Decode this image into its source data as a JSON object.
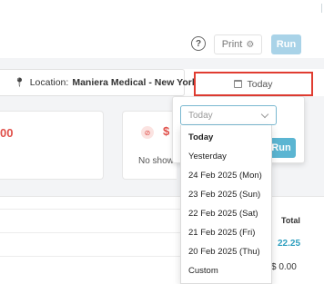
{
  "header": {
    "help_icon": "question-circle-icon",
    "print_label": "Print",
    "print_icon": "gear-icon",
    "run_label": "Run"
  },
  "filters": {
    "location_label": "Location:",
    "location_value": "Maniera Medical - New York",
    "date_label": "Today"
  },
  "cards": {
    "left_amount": "00",
    "right_amount": "$",
    "right_caption": "No show"
  },
  "table": {
    "total_header": "Total",
    "totals": [
      "22.25",
      "$ 0.00"
    ]
  },
  "date_popover": {
    "select_value": "Today",
    "run_label": "Run",
    "options": [
      "Today",
      "Yesterday",
      "24 Feb 2025 (Mon)",
      "23 Feb 2025 (Sun)",
      "22 Feb 2025 (Sat)",
      "21 Feb 2025 (Fri)",
      "20 Feb 2025 (Thu)",
      "Custom"
    ],
    "selected_option": "Today"
  },
  "colors": {
    "highlight_border": "#e03c31",
    "accent": "#5bb5d2",
    "danger": "#e0504a"
  }
}
